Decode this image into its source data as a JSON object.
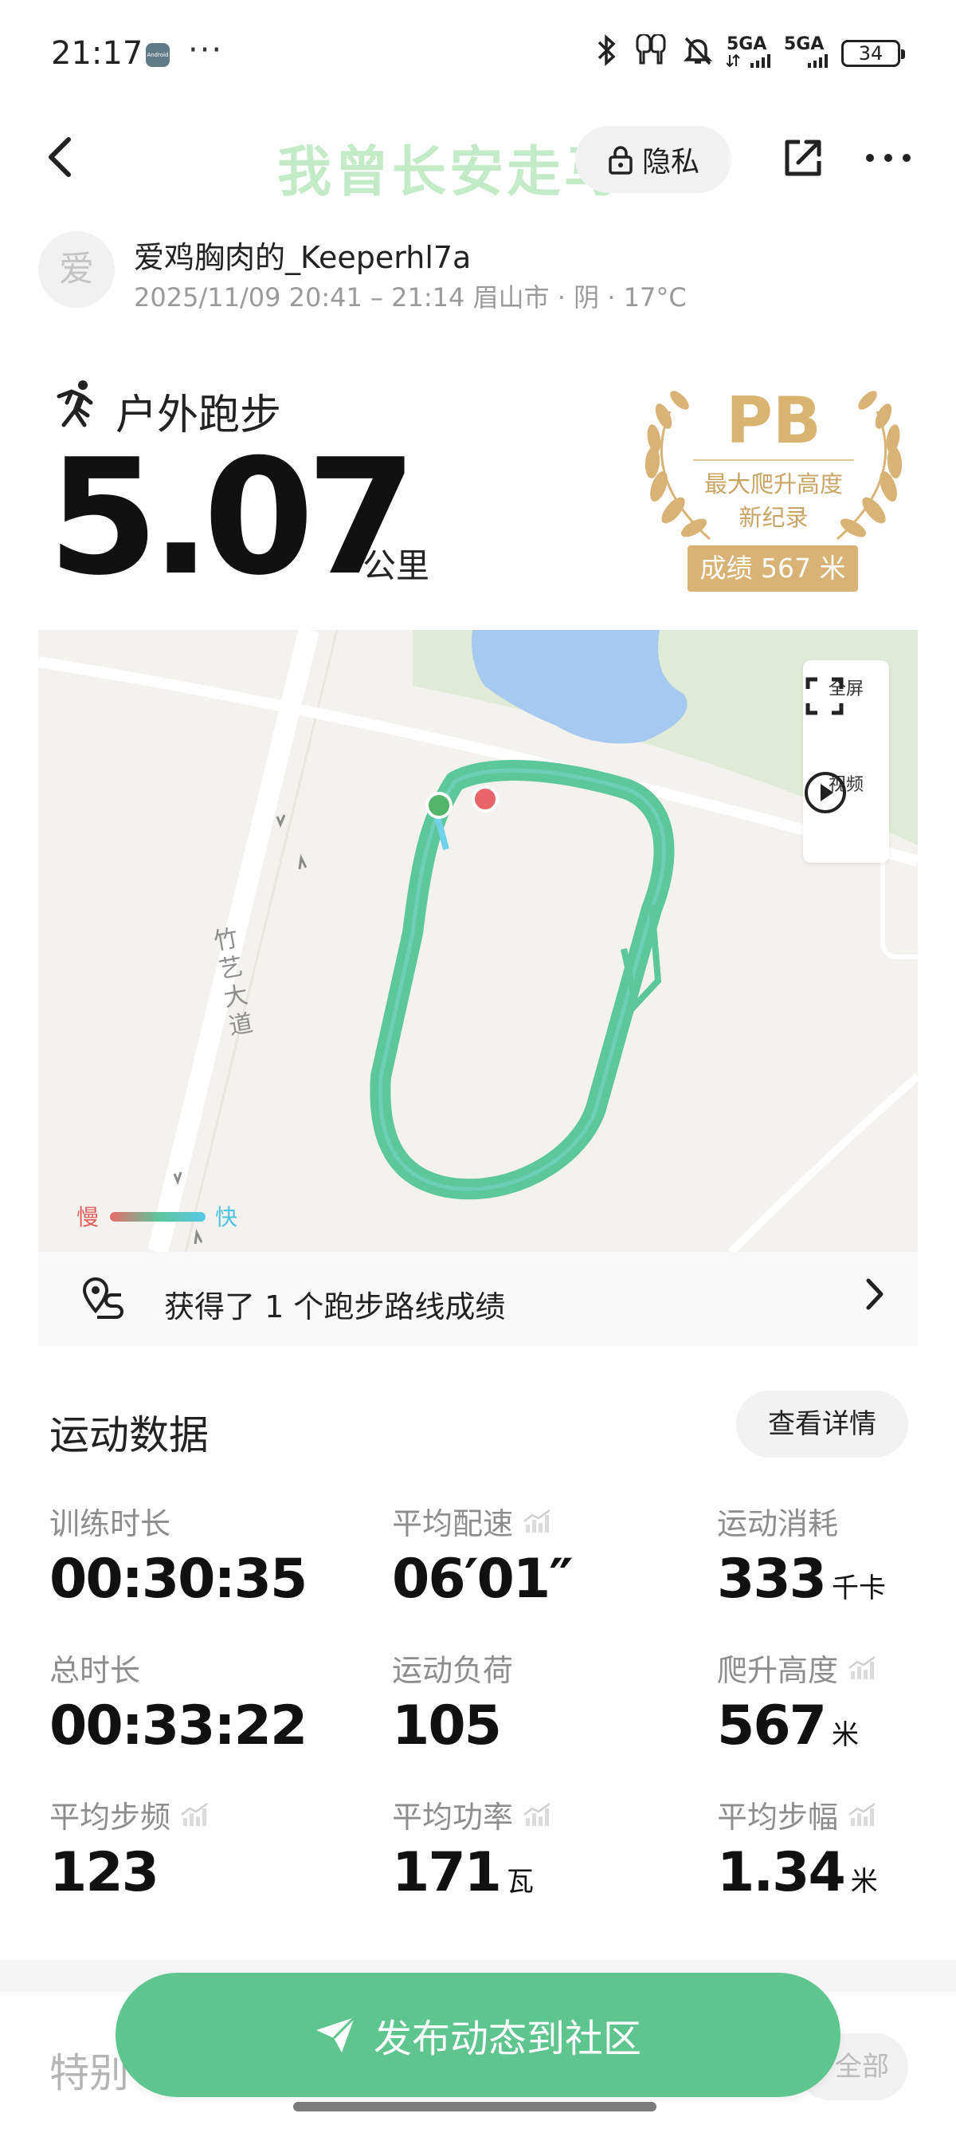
{
  "status_bar": {
    "time": "21:17",
    "app_icon_text": "Android",
    "more_dots": "···",
    "signal_1": "5GA",
    "signal_2": "5GA",
    "battery": "34",
    "icons": [
      "bluetooth-icon",
      "earbuds-icon",
      "mute-bell-icon",
      "signal-icon",
      "battery-icon"
    ]
  },
  "header": {
    "watermark": "我曾长安走马",
    "privacy_label": "隐私"
  },
  "user": {
    "avatar_char": "爱",
    "name": "爱鸡胸肉的_Keeperhl7a",
    "meta": "2025/11/09 20:41 – 21:14 眉山市 · 阴 · 17°C"
  },
  "activity": {
    "type": "户外跑步",
    "distance": "5.07",
    "unit": "公里"
  },
  "pb_badge": {
    "title": "PB",
    "line1": "最大爬升高度",
    "line2": "新纪录",
    "result": "成绩 567 米",
    "color": "#d8b375"
  },
  "map": {
    "road_name": "竹艺大道",
    "fullscreen_label": "全屏",
    "video_label": "视频",
    "legend_slow": "慢",
    "legend_fast": "快",
    "route_color": "#5cc79a"
  },
  "route_achievement": {
    "text": "获得了 1 个跑步路线成绩"
  },
  "stats_section": {
    "title": "运动数据",
    "detail_button": "查看详情",
    "items": [
      {
        "label": "训练时长",
        "value": "00:30:35",
        "unit": ""
      },
      {
        "label": "平均配速",
        "value": "06′01″",
        "unit": ""
      },
      {
        "label": "运动消耗",
        "value": "333",
        "unit": "千卡"
      },
      {
        "label": "总时长",
        "value": "00:33:22",
        "unit": ""
      },
      {
        "label": "运动负荷",
        "value": "105",
        "unit": ""
      },
      {
        "label": "爬升高度",
        "value": "567",
        "unit": "米"
      },
      {
        "label": "平均步频",
        "value": "123",
        "unit": ""
      },
      {
        "label": "平均功率",
        "value": "171",
        "unit": "瓦"
      },
      {
        "label": "平均步幅",
        "value": "1.34",
        "unit": "米"
      }
    ]
  },
  "special_section": {
    "title": "特别",
    "all_button": "全部"
  },
  "publish_button": {
    "label": "发布动态到社区",
    "color": "#5fc58f"
  }
}
